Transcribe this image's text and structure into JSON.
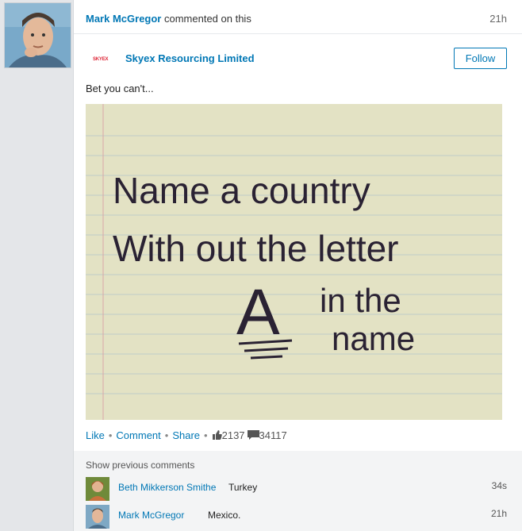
{
  "activity": {
    "actor_name": "Mark McGregor",
    "action_text": " commented on this",
    "time": "21h"
  },
  "company": {
    "logo_text": "SKYEX",
    "name": "Skyex Resourcing Limited",
    "follow_label": "Follow"
  },
  "post": {
    "text": "Bet you can't...",
    "image_lines": [
      "Name a country",
      "With out the letter",
      "A",
      "in the",
      "name"
    ]
  },
  "actions": {
    "like_label": "Like",
    "comment_label": "Comment",
    "share_label": "Share",
    "like_count": "2137",
    "comment_count": "34117",
    "separator": "•"
  },
  "comments": {
    "show_previous_label": "Show previous comments",
    "items": [
      {
        "author": "Beth Mikkerson Smithe",
        "text": "Turkey",
        "time": "34s"
      },
      {
        "author": "Mark McGregor",
        "text": "Mexico.",
        "time": "21h"
      }
    ]
  },
  "colors": {
    "link": "#0077b5",
    "paper": "#e4e3c8",
    "ink": "#2a2233"
  }
}
